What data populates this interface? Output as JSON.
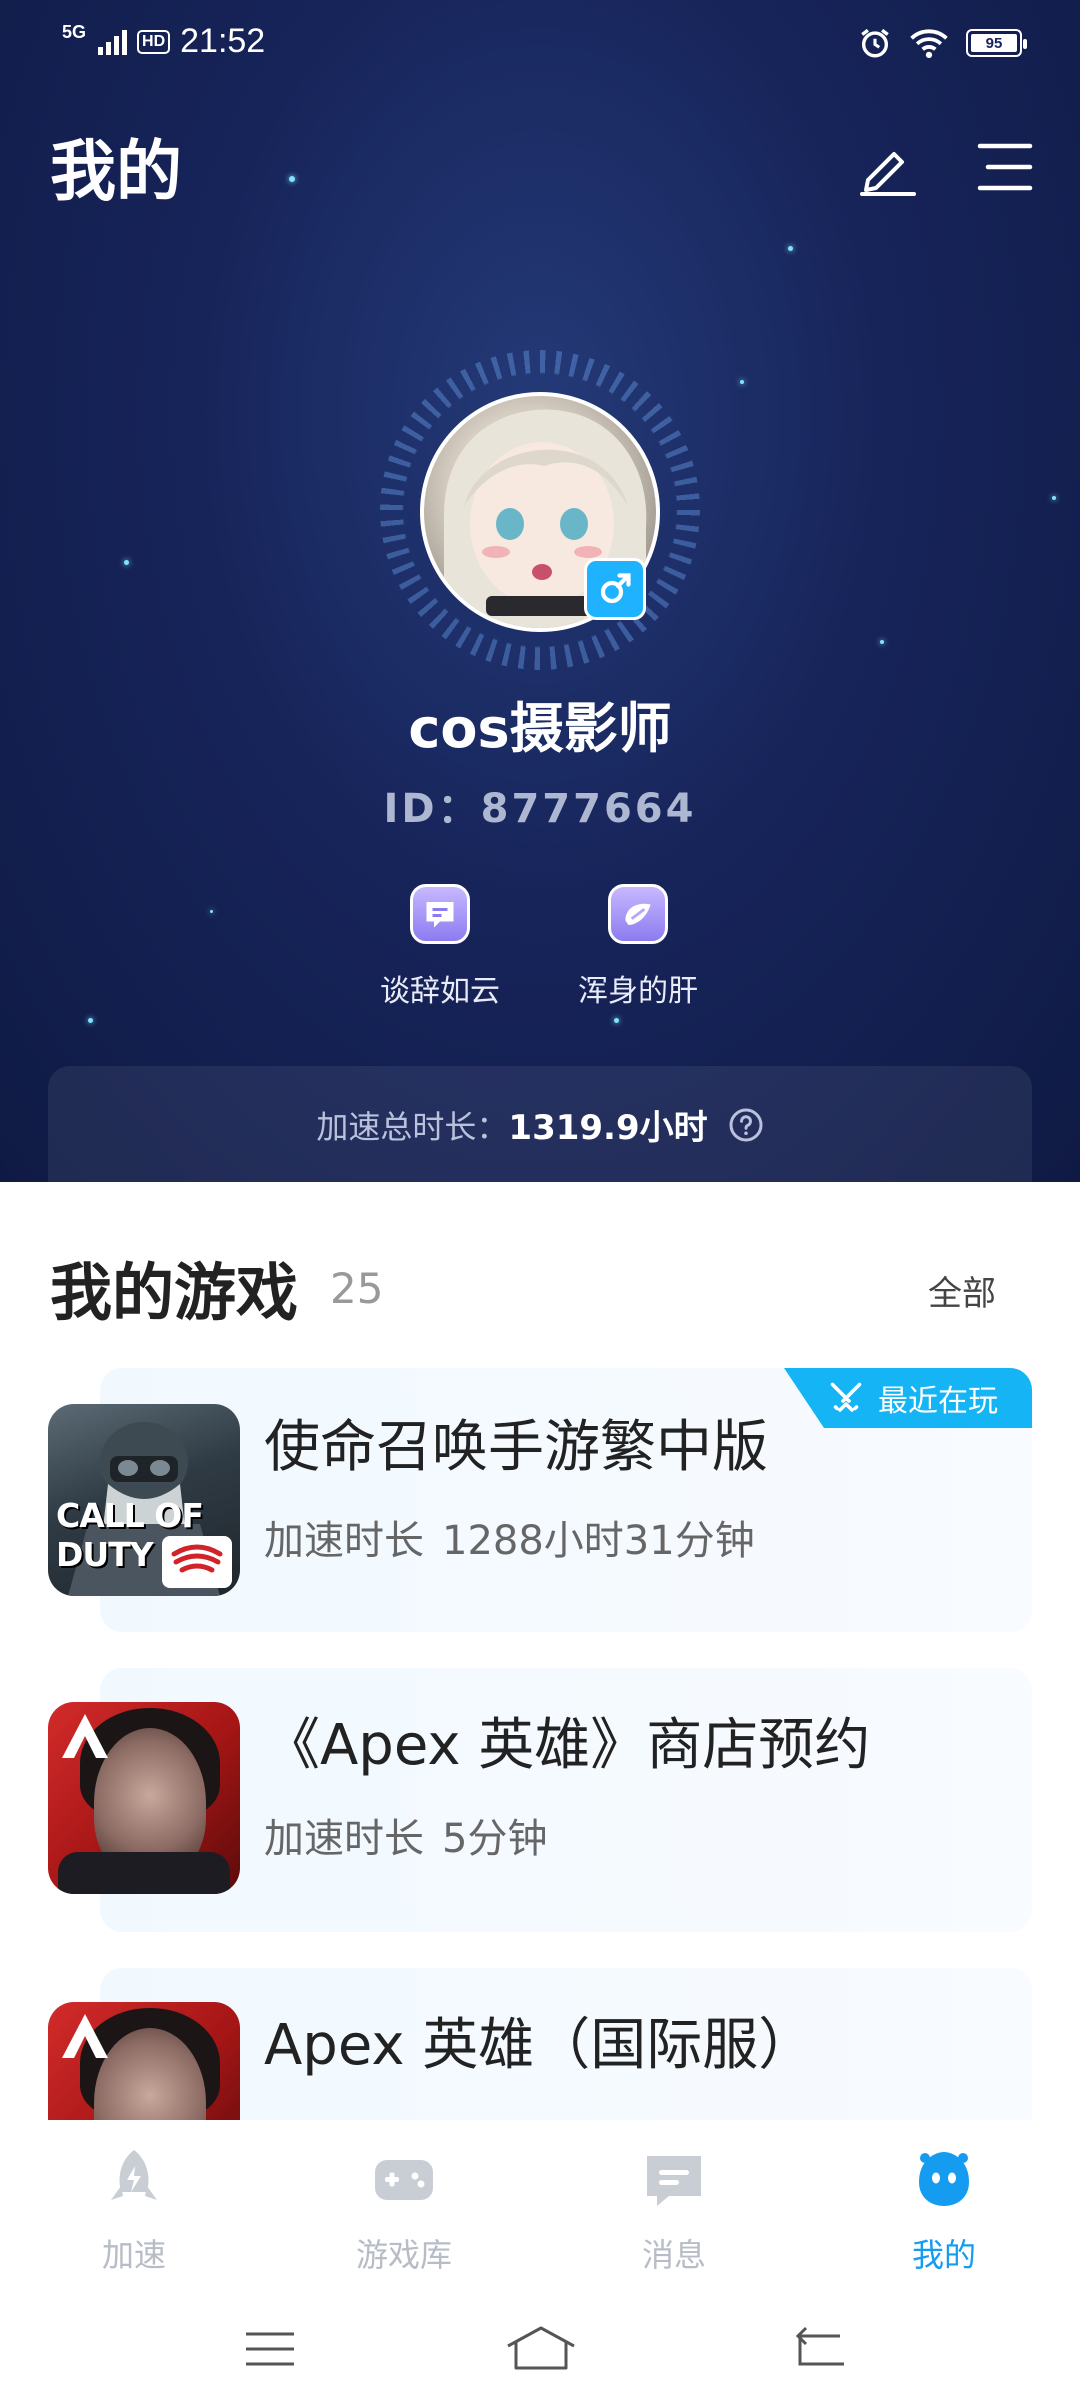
{
  "status_bar": {
    "network": "5G",
    "hd": "HD",
    "time": "21:52",
    "battery": "95"
  },
  "header": {
    "title": "我的",
    "edit_icon": "pencil-icon",
    "menu_icon": "menu-icon"
  },
  "profile": {
    "username": "cos摄影师",
    "user_id": "ID：8777664",
    "gender": "male",
    "badges": [
      {
        "label": "谈辞如云",
        "icon": "chat-bubble-icon"
      },
      {
        "label": "浑身的肝",
        "icon": "liver-icon"
      }
    ],
    "duration_label": "加速总时长：",
    "duration_value": "1319.9小时"
  },
  "my_games": {
    "title": "我的游戏",
    "count": "25",
    "see_all": "全部",
    "recent_tag": "最近在玩",
    "items": [
      {
        "name": "使命召唤手游繁中版",
        "time_label": "加速时长",
        "time_value": "1288小时31分钟",
        "icon_text": "CALL OF DUTY"
      },
      {
        "name": "《Apex 英雄》商店预约",
        "time_label": "加速时长",
        "time_value": "5分钟"
      },
      {
        "name": "Apex 英雄（国际服）"
      }
    ]
  },
  "tabs": [
    {
      "label": "加速",
      "icon": "rocket-icon",
      "active": false
    },
    {
      "label": "游戏库",
      "icon": "gamepad-icon",
      "active": false
    },
    {
      "label": "消息",
      "icon": "message-icon",
      "active": false
    },
    {
      "label": "我的",
      "icon": "mascot-icon",
      "active": true
    }
  ],
  "colors": {
    "accent": "#159cf0",
    "hero_bg": "#17245a",
    "tag": "#14b4f5"
  }
}
